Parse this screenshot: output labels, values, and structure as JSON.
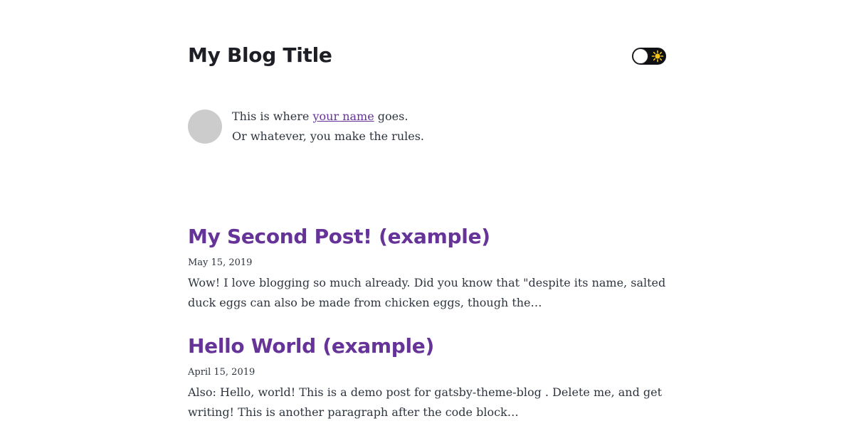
{
  "header": {
    "title": "My Blog Title",
    "theme_toggle": {
      "icon": "sun-icon",
      "state": "light"
    }
  },
  "bio": {
    "line1_prefix": "This is where ",
    "link_text": "your name",
    "line1_suffix": " goes.",
    "line2": "Or whatever, you make the rules."
  },
  "posts": [
    {
      "title": "My Second Post! (example)",
      "date": "May 15, 2019",
      "excerpt": "Wow! I love blogging so much already. Did you know that \"despite its name, salted duck eggs can also be made from chicken eggs, though the…"
    },
    {
      "title": "Hello World (example)",
      "date": "April 15, 2019",
      "excerpt": "Also: Hello, world! This is a demo post for gatsby-theme-blog . Delete me, and get writing! This is another paragraph after the code block…"
    }
  ],
  "colors": {
    "accent": "#663399",
    "text": "#2e353f",
    "title": "#1e1f26",
    "avatar": "#cccccc",
    "toggle_bg": "#0f1114",
    "sun": "#f5c518"
  }
}
